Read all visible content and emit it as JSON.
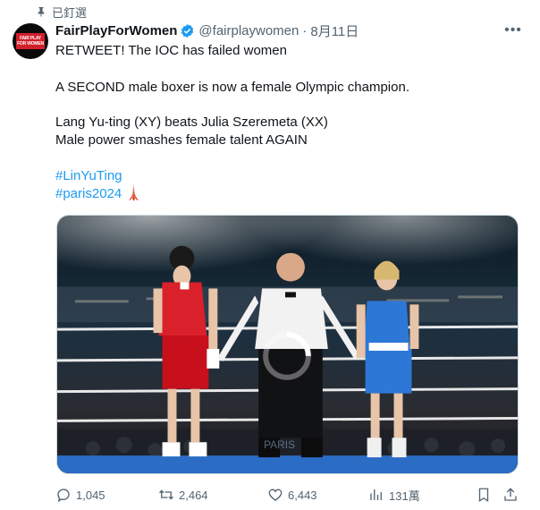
{
  "pinned": {
    "label": "已釘選"
  },
  "author": {
    "display_name": "FairPlayForWomen",
    "handle": "@fairplaywomen",
    "separator": "·",
    "date": "8月11日",
    "avatar_text": "FAIR PLAY FOR WOMEN"
  },
  "tweet": {
    "line1": "RETWEET!  The IOC has failed women",
    "line2": "A SECOND male boxer is now a female Olympic champion.",
    "line3": "Lang Yu-ting (XY) beats Julia Szeremeta (XX)",
    "line4": "Male power smashes female talent AGAIN",
    "hashtag1": "#LinYuTing",
    "hashtag2": "#paris2024",
    "emoji": "🗼"
  },
  "media": {
    "watermark": "PARIS"
  },
  "stats": {
    "replies": "1,045",
    "retweets": "2,464",
    "likes": "6,443",
    "views": "131萬"
  },
  "icons": {
    "pin": "pin-icon",
    "verified": "verified-badge-icon",
    "more": "more-icon",
    "reply": "reply-icon",
    "retweet": "retweet-icon",
    "like": "heart-icon",
    "views": "views-icon",
    "bookmark": "bookmark-icon",
    "share": "share-icon"
  },
  "colors": {
    "accent": "#1d9bf0",
    "muted": "#536471",
    "text": "#0f1419"
  }
}
